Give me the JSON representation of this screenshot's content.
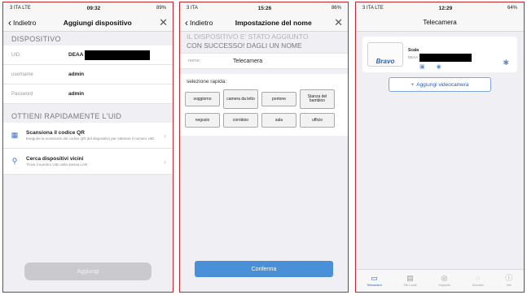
{
  "screen1": {
    "status": {
      "carrier": "3 ITA  LTE",
      "time": "09:32",
      "battery": "89%"
    },
    "nav": {
      "back": "Indietro",
      "title": "Aggiungi dispositivo"
    },
    "section_device": "DISPOSITIVO",
    "uid": {
      "label": "UID:",
      "value": "DEAA"
    },
    "username": {
      "label": "username",
      "value": "admin"
    },
    "password": {
      "label": "Password",
      "value": "admin"
    },
    "section_uid": "OTTIENI RAPIDAMENTE L'UID",
    "qr": {
      "title": "Scansiona il codice QR",
      "desc": "Eseguire la scansione del codice QR del dispositivo per ottenere il numero UID"
    },
    "nearby": {
      "title": "Cerca dispositivi vicini",
      "desc": "Trova il numero UID nella stessa LAN"
    },
    "add_button": "Aggiungi"
  },
  "screen2": {
    "status": {
      "carrier": "3 ITA",
      "time": "15:26",
      "battery": "86%"
    },
    "nav": {
      "back": "Indietro",
      "title": "Impostazione del nome"
    },
    "header_faded": "IL DISPOSITIVO E' STATO AGGIUNTO",
    "header": "CON SUCCESSO! DAGLI UN NOME",
    "name": {
      "label": "nome:",
      "value": "Telecamera"
    },
    "quick_label": "selezione rapida:",
    "chips_row1": [
      "soggiorno",
      "camera da letto",
      "portone",
      "Stanza del bambino"
    ],
    "chips_row2": [
      "negozio",
      "corridoio",
      "sala",
      "ufficio"
    ],
    "confirm_button": "Conferma"
  },
  "screen3": {
    "status": {
      "carrier": "3 ITA  LTE",
      "time": "12:29",
      "battery": "64%"
    },
    "title": "Telecamera",
    "camera": {
      "name": "Scala",
      "uid": "DEAA",
      "logo": "Bravo"
    },
    "add_camera_button": "Aggiungi videocamera",
    "tabs": [
      {
        "label": "Telecamera",
        "icon": "camera-icon"
      },
      {
        "label": "File Locali",
        "icon": "image-icon"
      },
      {
        "label": "Supporto",
        "icon": "support-icon"
      },
      {
        "label": "Domotici",
        "icon": "home-icon"
      },
      {
        "label": "Info",
        "icon": "info-icon"
      }
    ]
  }
}
